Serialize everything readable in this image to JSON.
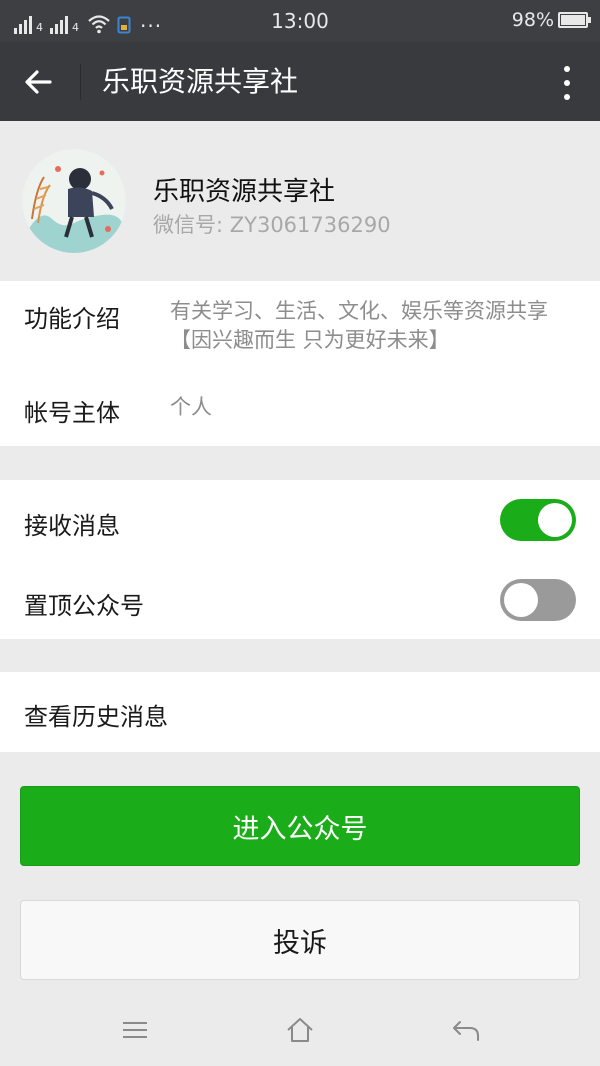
{
  "status_bar": {
    "signal1_label": "4",
    "signal2_label": "4",
    "more": "···",
    "time": "13:00",
    "battery": "98%"
  },
  "navbar": {
    "title": "乐职资源共享社"
  },
  "profile": {
    "name": "乐职资源共享社",
    "wechat_id": "微信号: ZY3061736290"
  },
  "info": {
    "intro_label": "功能介绍",
    "intro_value": "有关学习、生活、文化、娱乐等资源共享【因兴趣而生 只为更好未来】",
    "owner_label": "帐号主体",
    "owner_value": "个人"
  },
  "settings": {
    "receive_label": "接收消息",
    "receive_on": true,
    "pin_label": "置顶公众号",
    "pin_on": false
  },
  "history": {
    "label": "查看历史消息"
  },
  "buttons": {
    "enter": "进入公众号",
    "complain": "投诉"
  },
  "colors": {
    "accent": "#1aad19",
    "navbar": "#393a3e"
  },
  "icons": {
    "back": "arrow-left-icon",
    "more": "more-vertical-icon",
    "menu": "menu-icon",
    "home": "home-icon",
    "return": "return-icon"
  }
}
